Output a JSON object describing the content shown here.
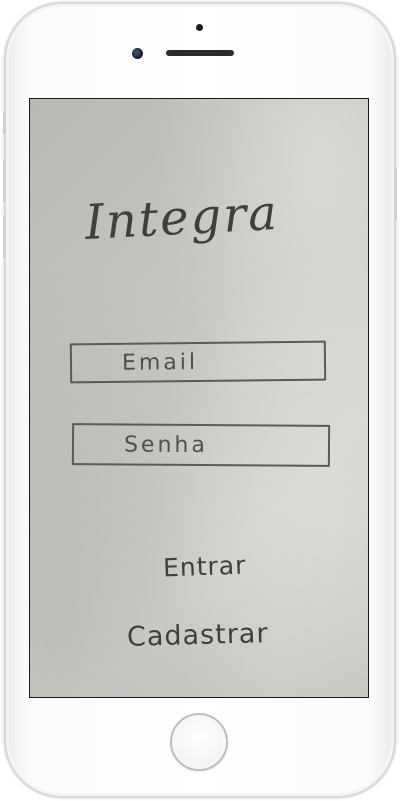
{
  "app": {
    "title": "Integra"
  },
  "login_form": {
    "email_placeholder": "Email",
    "password_placeholder": "Senha"
  },
  "actions": {
    "entrar_label": "Entrar",
    "cadastrar_label": "Cadastrar"
  },
  "device": {
    "frame_color": "#f4f4f4",
    "icons": [
      "front-camera-icon",
      "earpiece-speaker-icon",
      "proximity-sensor-icon",
      "home-button"
    ]
  }
}
